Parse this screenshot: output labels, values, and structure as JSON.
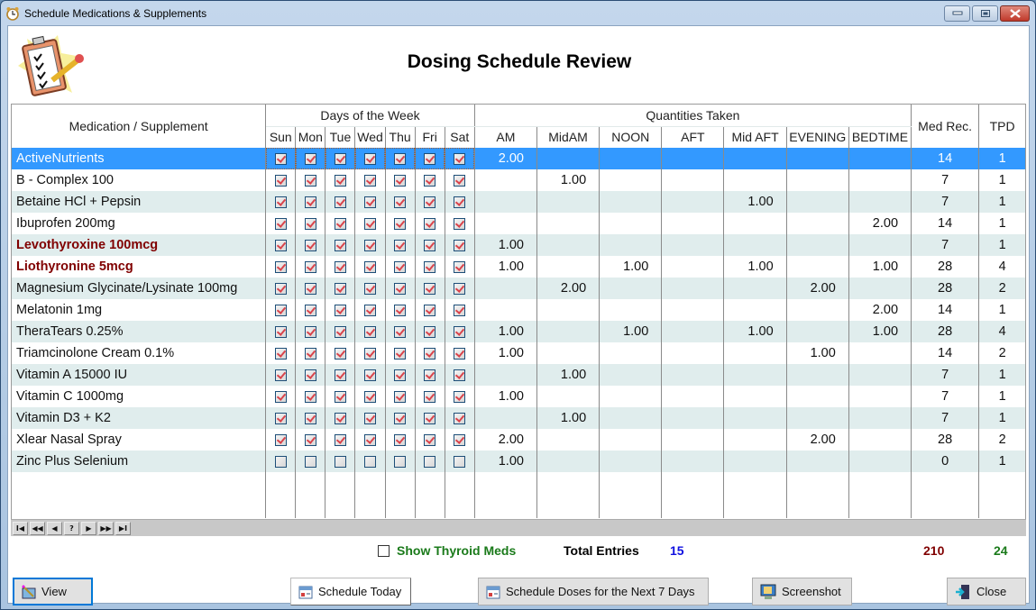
{
  "window": {
    "title": "Schedule Medications & Supplements",
    "icon": "alarm-clock-icon",
    "controls": [
      "minimize",
      "maximize",
      "close"
    ]
  },
  "header": {
    "logo": "clipboard-checklist-icon",
    "title": "Dosing Schedule Review"
  },
  "grid": {
    "header_groups": {
      "medication": "Medication / Supplement",
      "days": "Days of the Week",
      "quantities": "Quantities Taken",
      "med_rec": "Med Rec.",
      "tpd": "TPD"
    },
    "day_columns": [
      "Sun",
      "Mon",
      "Tue",
      "Wed",
      "Thu",
      "Fri",
      "Sat"
    ],
    "quantity_columns": [
      "AM",
      "MidAM",
      "NOON",
      "AFT",
      "Mid AFT",
      "EVENING",
      "BEDTIME"
    ],
    "selected_row": 0,
    "rows": [
      {
        "name": "ActiveNutrients",
        "thyroid": false,
        "days": [
          true,
          true,
          true,
          true,
          true,
          true,
          true
        ],
        "qty": [
          "2.00",
          "",
          "",
          "",
          "",
          "",
          ""
        ],
        "med_rec": "14",
        "tpd": "1"
      },
      {
        "name": "B - Complex 100",
        "thyroid": false,
        "days": [
          true,
          true,
          true,
          true,
          true,
          true,
          true
        ],
        "qty": [
          "",
          "1.00",
          "",
          "",
          "",
          "",
          ""
        ],
        "med_rec": "7",
        "tpd": "1"
      },
      {
        "name": "Betaine HCl + Pepsin",
        "thyroid": false,
        "days": [
          true,
          true,
          true,
          true,
          true,
          true,
          true
        ],
        "qty": [
          "",
          "",
          "",
          "",
          "1.00",
          "",
          ""
        ],
        "med_rec": "7",
        "tpd": "1"
      },
      {
        "name": "Ibuprofen 200mg",
        "thyroid": false,
        "days": [
          true,
          true,
          true,
          true,
          true,
          true,
          true
        ],
        "qty": [
          "",
          "",
          "",
          "",
          "",
          "",
          "2.00"
        ],
        "med_rec": "14",
        "tpd": "1"
      },
      {
        "name": "Levothyroxine 100mcg",
        "thyroid": true,
        "days": [
          true,
          true,
          true,
          true,
          true,
          true,
          true
        ],
        "qty": [
          "1.00",
          "",
          "",
          "",
          "",
          "",
          ""
        ],
        "med_rec": "7",
        "tpd": "1"
      },
      {
        "name": "Liothyronine 5mcg",
        "thyroid": true,
        "days": [
          true,
          true,
          true,
          true,
          true,
          true,
          true
        ],
        "qty": [
          "1.00",
          "",
          "1.00",
          "",
          "1.00",
          "",
          "1.00"
        ],
        "med_rec": "28",
        "tpd": "4"
      },
      {
        "name": "Magnesium Glycinate/Lysinate 100mg",
        "thyroid": false,
        "days": [
          true,
          true,
          true,
          true,
          true,
          true,
          true
        ],
        "qty": [
          "",
          "2.00",
          "",
          "",
          "",
          "2.00",
          ""
        ],
        "med_rec": "28",
        "tpd": "2"
      },
      {
        "name": "Melatonin 1mg",
        "thyroid": false,
        "days": [
          true,
          true,
          true,
          true,
          true,
          true,
          true
        ],
        "qty": [
          "",
          "",
          "",
          "",
          "",
          "",
          "2.00"
        ],
        "med_rec": "14",
        "tpd": "1"
      },
      {
        "name": "TheraTears 0.25%",
        "thyroid": false,
        "days": [
          true,
          true,
          true,
          true,
          true,
          true,
          true
        ],
        "qty": [
          "1.00",
          "",
          "1.00",
          "",
          "1.00",
          "",
          "1.00"
        ],
        "med_rec": "28",
        "tpd": "4"
      },
      {
        "name": "Triamcinolone Cream 0.1%",
        "thyroid": false,
        "days": [
          true,
          true,
          true,
          true,
          true,
          true,
          true
        ],
        "qty": [
          "1.00",
          "",
          "",
          "",
          "",
          "1.00",
          ""
        ],
        "med_rec": "14",
        "tpd": "2"
      },
      {
        "name": "Vitamin A 15000 IU",
        "thyroid": false,
        "days": [
          true,
          true,
          true,
          true,
          true,
          true,
          true
        ],
        "qty": [
          "",
          "1.00",
          "",
          "",
          "",
          "",
          ""
        ],
        "med_rec": "7",
        "tpd": "1"
      },
      {
        "name": "Vitamin C 1000mg",
        "thyroid": false,
        "days": [
          true,
          true,
          true,
          true,
          true,
          true,
          true
        ],
        "qty": [
          "1.00",
          "",
          "",
          "",
          "",
          "",
          ""
        ],
        "med_rec": "7",
        "tpd": "1"
      },
      {
        "name": "Vitamin D3 + K2",
        "thyroid": false,
        "days": [
          true,
          true,
          true,
          true,
          true,
          true,
          true
        ],
        "qty": [
          "",
          "1.00",
          "",
          "",
          "",
          "",
          ""
        ],
        "med_rec": "7",
        "tpd": "1"
      },
      {
        "name": "Xlear Nasal Spray",
        "thyroid": false,
        "days": [
          true,
          true,
          true,
          true,
          true,
          true,
          true
        ],
        "qty": [
          "2.00",
          "",
          "",
          "",
          "",
          "2.00",
          ""
        ],
        "med_rec": "28",
        "tpd": "2"
      },
      {
        "name": "Zinc Plus Selenium",
        "thyroid": false,
        "days": [
          false,
          false,
          false,
          false,
          false,
          false,
          false
        ],
        "qty": [
          "1.00",
          "",
          "",
          "",
          "",
          "",
          ""
        ],
        "med_rec": "0",
        "tpd": "1"
      }
    ],
    "navigator": [
      {
        "name": "first-record",
        "glyph": "I◀"
      },
      {
        "name": "previous-page",
        "glyph": "◀◀"
      },
      {
        "name": "previous-record",
        "glyph": "◀"
      },
      {
        "name": "help",
        "glyph": "?"
      },
      {
        "name": "next-record",
        "glyph": "▶"
      },
      {
        "name": "next-page",
        "glyph": "▶▶"
      },
      {
        "name": "last-record",
        "glyph": "▶I"
      }
    ]
  },
  "footer": {
    "show_thyroid_label": "Show Thyroid Meds",
    "show_thyroid_checked": false,
    "total_entries_label": "Total Entries",
    "total_entries": "15",
    "total_med_rec": "210",
    "total_tpd": "24",
    "colors": {
      "thyroid_label": "#1a7a1a",
      "entries": "#1010e0",
      "med_rec": "#800000",
      "tpd": "#1a7a1a"
    }
  },
  "buttons": {
    "view": "View",
    "schedule_today": "Schedule Today",
    "schedule_week": "Schedule Doses for the Next 7 Days",
    "screenshot": "Screenshot",
    "close": "Close"
  }
}
